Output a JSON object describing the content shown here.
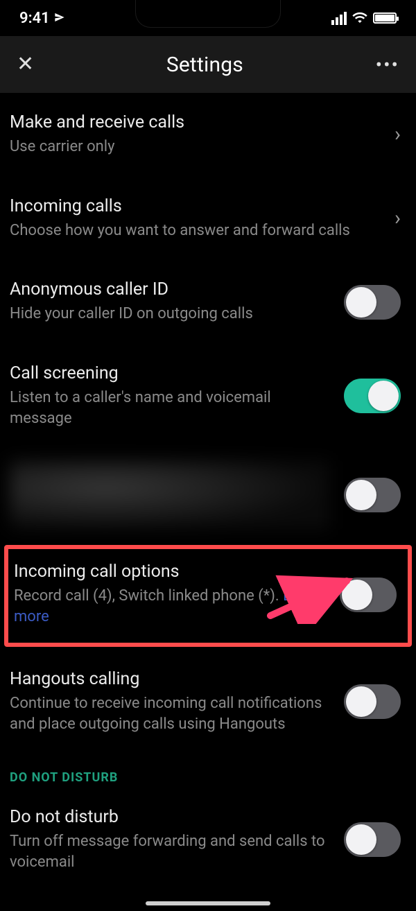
{
  "status": {
    "time": "9:41"
  },
  "header": {
    "title": "Settings"
  },
  "rows": {
    "make_receive": {
      "title": "Make and receive calls",
      "sub": "Use carrier only"
    },
    "incoming": {
      "title": "Incoming calls",
      "sub": "Choose how you want to answer and forward calls"
    },
    "anon": {
      "title": "Anonymous caller ID",
      "sub": "Hide your caller ID on outgoing calls",
      "on": false
    },
    "screening": {
      "title": "Call screening",
      "sub": "Listen to a caller's name and voicemail message",
      "on": true
    },
    "redacted": {
      "on": false
    },
    "options": {
      "title": "Incoming call options",
      "sub_prefix": "Record call (4), Switch linked phone (*). ",
      "link": "Learn more",
      "on": false
    },
    "hangouts": {
      "title": "Hangouts calling",
      "sub": "Continue to receive incoming call notifications and place outgoing calls using Hangouts",
      "on": false
    },
    "dnd_section": "DO NOT DISTURB",
    "dnd": {
      "title": "Do not disturb",
      "sub": "Turn off message forwarding and send calls to voicemail",
      "on": false
    }
  }
}
